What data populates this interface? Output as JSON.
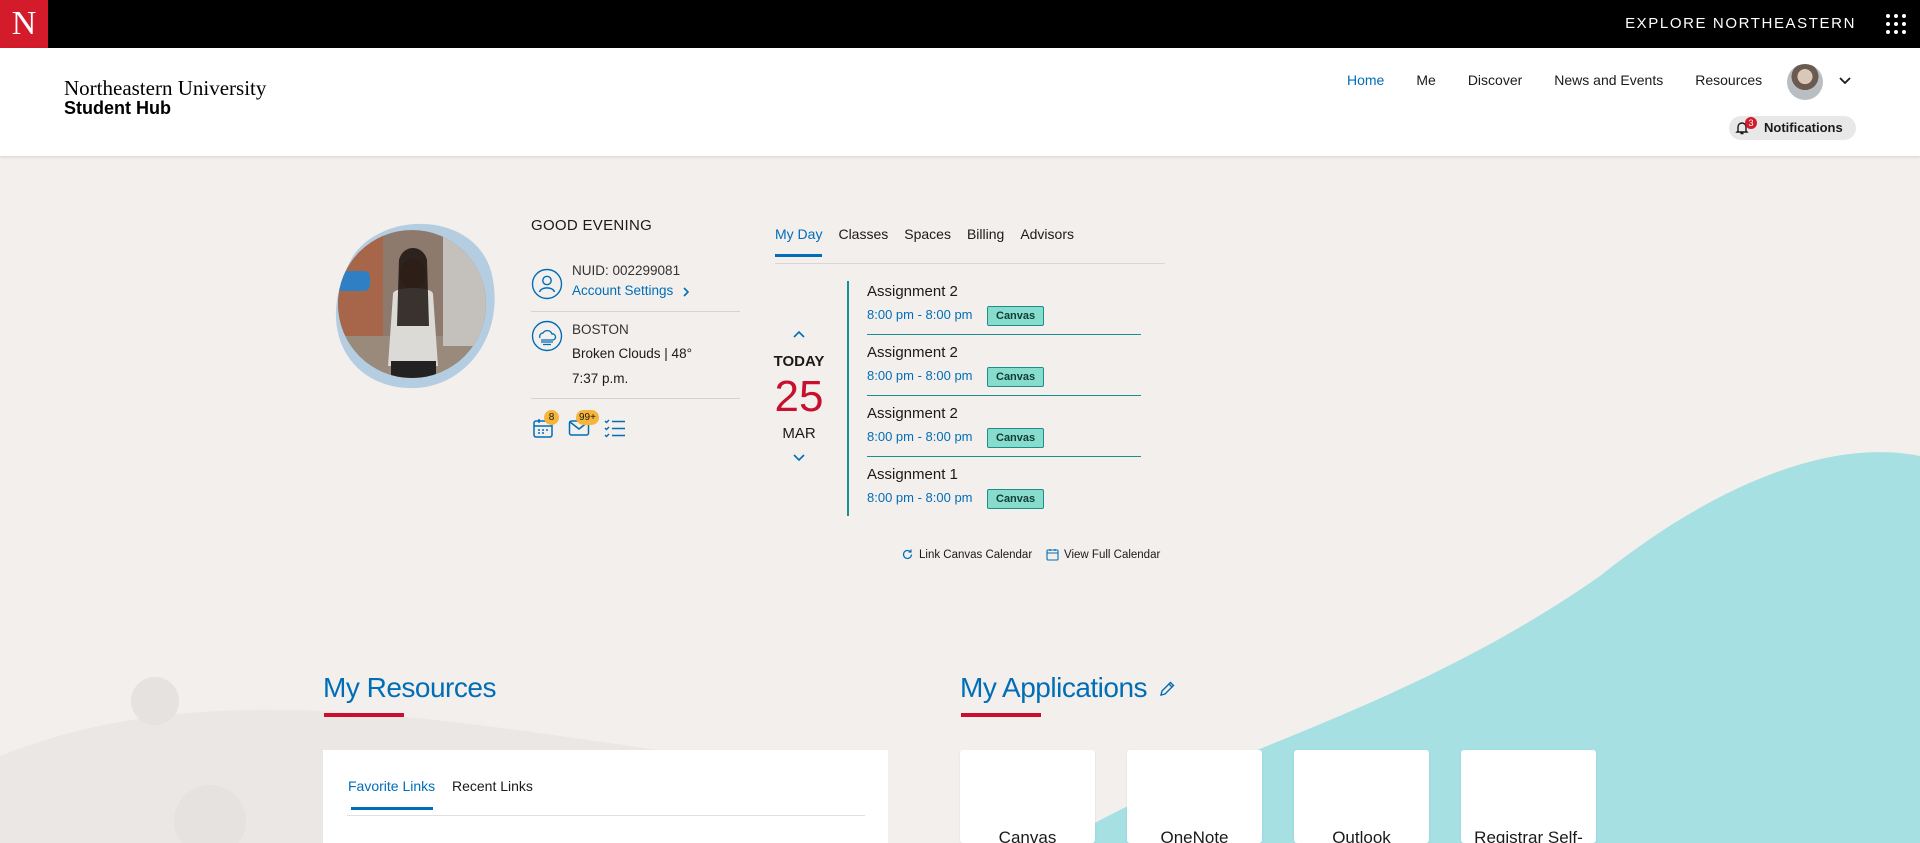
{
  "topbar": {
    "logo_letter": "N",
    "explore_label": "EXPLORE NORTHEASTERN"
  },
  "header": {
    "brand_university": "Northeastern University",
    "brand_hub": "Student Hub",
    "nav": [
      "Home",
      "Me",
      "Discover",
      "News and Events",
      "Resources"
    ],
    "active_nav": "Home",
    "notifications": {
      "label": "Notifications",
      "count": "3"
    }
  },
  "profile": {
    "greeting": "GOOD EVENING",
    "nuid": "NUID: 002299081",
    "account_settings": "Account Settings",
    "city": "BOSTON",
    "weather": "Broken Clouds | 48°",
    "time": "7:37 p.m.",
    "calendar_badge": "8",
    "mail_badge": "99+"
  },
  "day_tabs": [
    "My Day",
    "Classes",
    "Spaces",
    "Billing",
    "Advisors"
  ],
  "date": {
    "today_label": "TODAY",
    "day": "25",
    "month": "MAR"
  },
  "events": [
    {
      "title": "Assignment 2",
      "time": "8:00 pm - 8:00 pm",
      "source": "Canvas"
    },
    {
      "title": "Assignment 2",
      "time": "8:00 pm - 8:00 pm",
      "source": "Canvas"
    },
    {
      "title": "Assignment 2",
      "time": "8:00 pm - 8:00 pm",
      "source": "Canvas"
    },
    {
      "title": "Assignment 1",
      "time": "8:00 pm - 8:00 pm",
      "source": "Canvas"
    }
  ],
  "calendar_links": {
    "link_canvas": "Link Canvas Calendar",
    "view_full": "View Full Calendar"
  },
  "resources": {
    "title": "My Resources",
    "tabs": [
      "Favorite Links",
      "Recent Links"
    ]
  },
  "applications": {
    "title": "My Applications",
    "apps": [
      "Canvas",
      "OneNote",
      "Outlook",
      "Registrar Self-"
    ]
  },
  "colors": {
    "brand_red": "#d41b2c",
    "link_blue": "#006eb7",
    "teal": "#a6e0e3",
    "canvas_pill": "#88dccb"
  }
}
